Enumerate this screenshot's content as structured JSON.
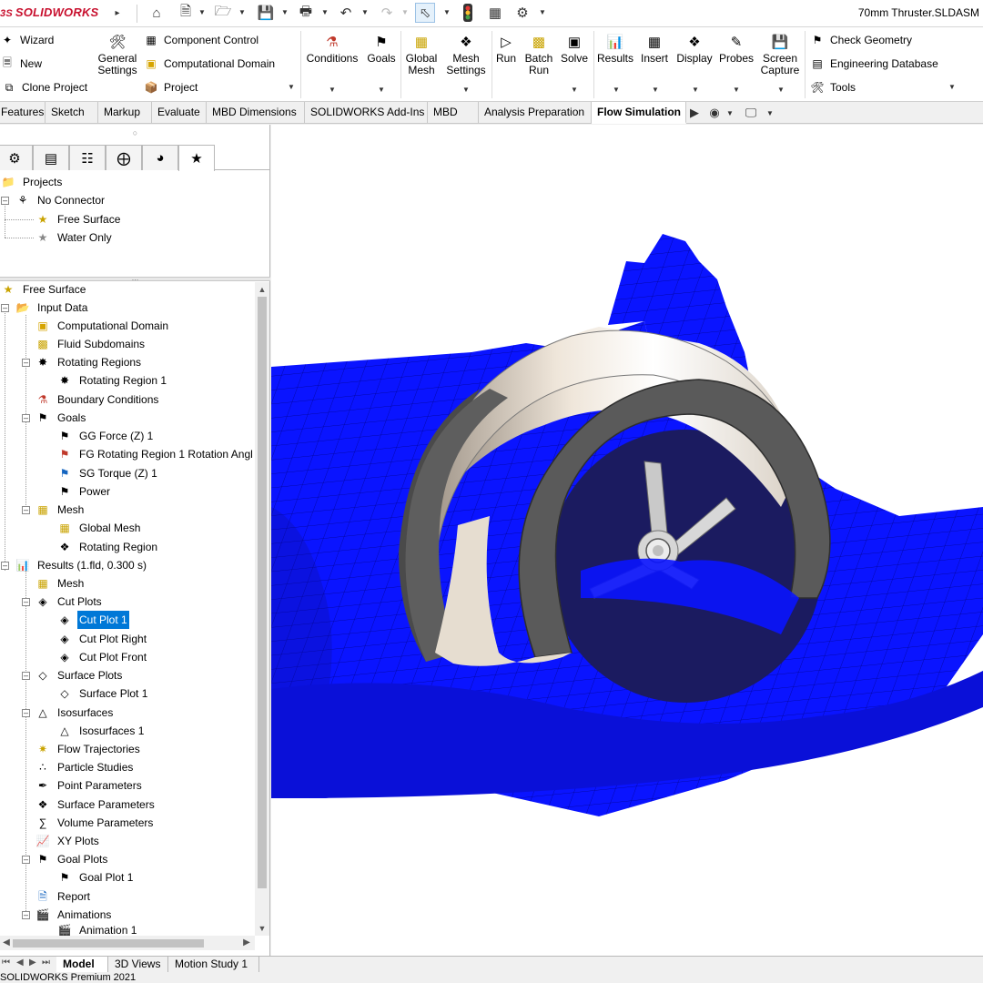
{
  "app": {
    "logo_text": "SOLIDWORKS",
    "logo_mark": "3S",
    "document_title": "70mm Thruster.SLDASM",
    "status_text": "SOLIDWORKS Premium 2021"
  },
  "ribbon": {
    "left_col": [
      "Wizard",
      "New",
      "Clone Project"
    ],
    "general_settings": "General\nSettings",
    "mid_col": [
      "Component Control",
      "Computational Domain",
      "Project"
    ],
    "buttons": [
      {
        "label": "Conditions"
      },
      {
        "label": "Goals"
      },
      {
        "label": "Global\nMesh"
      },
      {
        "label": "Mesh\nSettings"
      },
      {
        "label": "Run"
      },
      {
        "label": "Batch\nRun"
      },
      {
        "label": "Solve"
      },
      {
        "label": "Results"
      },
      {
        "label": "Insert"
      },
      {
        "label": "Display"
      },
      {
        "label": "Probes"
      },
      {
        "label": "Screen\nCapture"
      }
    ],
    "right_col": [
      "Check Geometry",
      "Engineering Database",
      "Tools"
    ]
  },
  "tabs": [
    "Features",
    "Sketch",
    "Markup",
    "Evaluate",
    "MBD Dimensions",
    "SOLIDWORKS Add-Ins",
    "MBD",
    "Analysis Preparation",
    "Flow Simulation"
  ],
  "active_tab": "Flow Simulation",
  "projects_tree": {
    "root": "Projects",
    "config": "No Connector",
    "items": [
      "Free Surface",
      "Water Only"
    ]
  },
  "analysis_tree": {
    "root": "Free Surface",
    "input_data": "Input Data",
    "computational_domain": "Computational Domain",
    "fluid_subdomains": "Fluid Subdomains",
    "rotating_regions": "Rotating Regions",
    "rotating_region_1": "Rotating Region 1",
    "boundary_conditions": "Boundary Conditions",
    "goals": "Goals",
    "goal_items": [
      "GG Force (Z) 1",
      "FG Rotating Region 1 Rotation Angl",
      "SG Torque (Z) 1",
      "Power"
    ],
    "mesh": "Mesh",
    "mesh_items": [
      "Global Mesh",
      "Rotating Region"
    ],
    "results": "Results (1.fld, 0.300 s)",
    "results_mesh": "Mesh",
    "cut_plots": "Cut Plots",
    "cut_plot_items": [
      "Cut Plot 1",
      "Cut Plot Right",
      "Cut Plot Front"
    ],
    "surface_plots": "Surface Plots",
    "surface_plot_1": "Surface Plot 1",
    "isosurfaces": "Isosurfaces",
    "isosurfaces_1": "Isosurfaces 1",
    "flow_trajectories": "Flow Trajectories",
    "particle_studies": "Particle Studies",
    "point_parameters": "Point Parameters",
    "surface_parameters": "Surface Parameters",
    "volume_parameters": "Volume Parameters",
    "xy_plots": "XY Plots",
    "goal_plots": "Goal Plots",
    "goal_plot_1": "Goal Plot 1",
    "report": "Report",
    "animations": "Animations",
    "animation_1": "Animation 1"
  },
  "selected_item": "Cut Plot 1",
  "bottom_tabs": [
    "Model",
    "3D Views",
    "Motion Study 1"
  ],
  "active_bottom_tab": "Model",
  "colors": {
    "water_surface": "#0a14ff",
    "selection": "#0078d7",
    "logo": "#c8102e"
  }
}
